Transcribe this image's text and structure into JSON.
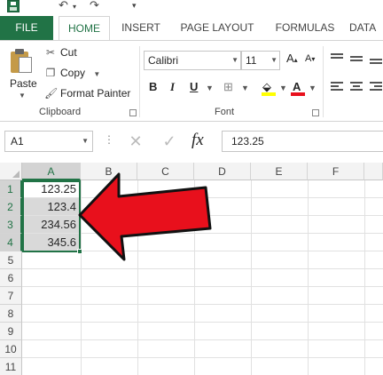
{
  "ribbon_tabs": {
    "file": "FILE",
    "home": "HOME",
    "insert": "INSERT",
    "page_layout": "PAGE LAYOUT",
    "formulas": "FORMULAS",
    "data": "DATA"
  },
  "clipboard": {
    "paste": "Paste",
    "cut": "Cut",
    "copy": "Copy",
    "format_painter": "Format Painter",
    "group_label": "Clipboard"
  },
  "font": {
    "name": "Calibri",
    "size": "11",
    "group_label": "Font",
    "bold": "B",
    "italic": "I",
    "underline": "U"
  },
  "formula_bar": {
    "name_box": "A1",
    "fx": "fx",
    "value": "123.25"
  },
  "sheet": {
    "columns": [
      "A",
      "B",
      "C",
      "D",
      "E",
      "F"
    ],
    "rows": [
      "1",
      "2",
      "3",
      "4",
      "5",
      "6",
      "7",
      "8",
      "9",
      "10",
      "11"
    ],
    "cells": {
      "A1": "123.25",
      "A2": "123.4",
      "A3": "234.56",
      "A4": "345.6"
    }
  },
  "colors": {
    "accent": "#217346",
    "arrow": "#e8101c",
    "font_color_swatch": "#e8101c",
    "fill_color_swatch": "#ffff00"
  }
}
